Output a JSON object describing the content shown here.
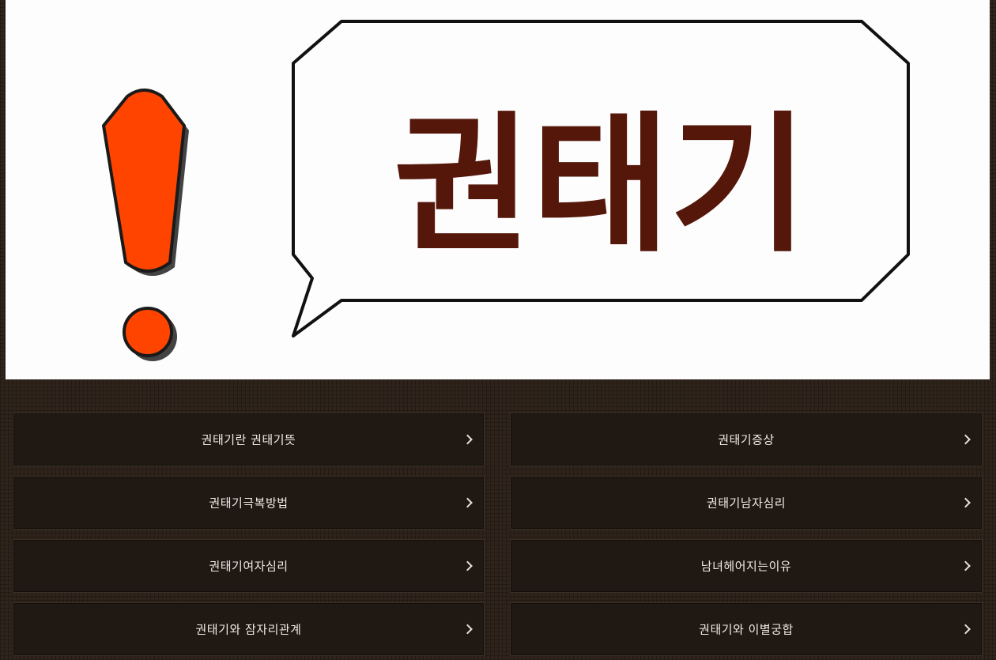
{
  "banner": {
    "title": "권태기",
    "icon": "exclamation-mark-icon",
    "colors": {
      "exclamation": "#ff4400",
      "title_text": "#55170a",
      "bubble_outline": "#111111"
    }
  },
  "menu": {
    "chevron_icon": "chevron-right-icon",
    "items": [
      {
        "label": "권태기란 권태기뜻"
      },
      {
        "label": "권태기증상"
      },
      {
        "label": "권태기극복방법"
      },
      {
        "label": "권태기남자심리"
      },
      {
        "label": "권태기여자심리"
      },
      {
        "label": "남녀헤어지는이유"
      },
      {
        "label": "권태기와 잠자리관계"
      },
      {
        "label": "권태기와 이별궁합"
      }
    ]
  }
}
